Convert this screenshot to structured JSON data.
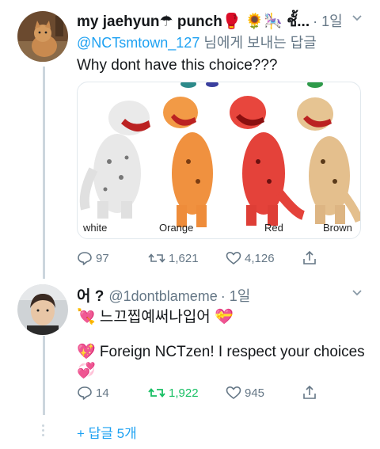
{
  "tweet1": {
    "display_name": "my jaehyun☂ punch🥊 🌻🎠 ชั้...",
    "time": "· 1일",
    "reply_to_prefix": "",
    "reply_to_mention": "@NCTsmtown_127",
    "reply_to_suffix": " 님에게 보내는 답글",
    "text": "Why dont have this choice???",
    "media": {
      "labels": [
        "white",
        "Orange",
        "Red",
        "Brown"
      ]
    },
    "actions": {
      "replies": "97",
      "retweets": "1,621",
      "likes": "4,126"
    }
  },
  "tweet2": {
    "display_name": "어 ?",
    "handle": "@1dontblameme",
    "time": "· 1일",
    "line1": "💘 느끄찝예써나입어 💝",
    "line2": "💖 Foreign NCTzen! I respect your choices",
    "line3": "💞",
    "actions": {
      "replies": "14",
      "retweets": "1,922",
      "likes": "945"
    }
  },
  "more_replies": "+ 답글 5개",
  "colors": {
    "accent": "#1da1f2",
    "muted": "#657786",
    "retweet_active": "#17bf63",
    "thread_line": "#ccd6dd"
  }
}
